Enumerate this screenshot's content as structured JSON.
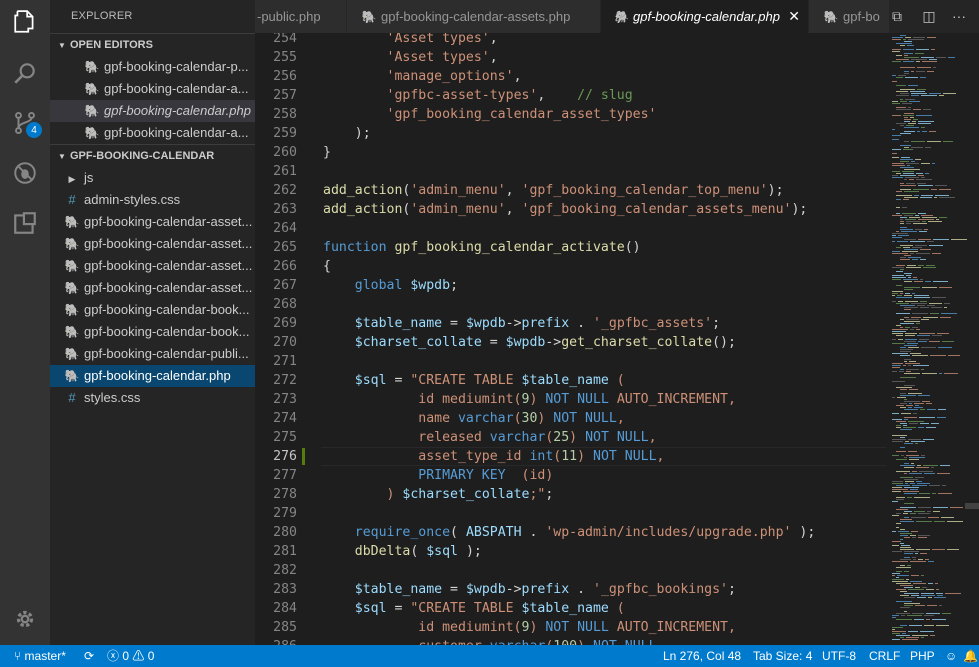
{
  "explorer": {
    "title": "EXPLORER",
    "open_editors_header": "OPEN EDITORS",
    "open_editors": [
      "gpf-booking-calendar-p...",
      "gpf-booking-calendar-a...",
      "gpf-booking-calendar.php",
      "gpf-booking-calendar-a..."
    ],
    "project_header": "GPF-BOOKING-CALENDAR",
    "files": [
      {
        "name": "js",
        "type": "folder"
      },
      {
        "name": "admin-styles.css",
        "type": "css"
      },
      {
        "name": "gpf-booking-calendar-asset...",
        "type": "php"
      },
      {
        "name": "gpf-booking-calendar-asset...",
        "type": "php"
      },
      {
        "name": "gpf-booking-calendar-asset...",
        "type": "php"
      },
      {
        "name": "gpf-booking-calendar-asset...",
        "type": "php"
      },
      {
        "name": "gpf-booking-calendar-book...",
        "type": "php"
      },
      {
        "name": "gpf-booking-calendar-book...",
        "type": "php"
      },
      {
        "name": "gpf-booking-calendar-publi...",
        "type": "php"
      },
      {
        "name": "gpf-booking-calendar.php",
        "type": "php"
      },
      {
        "name": "styles.css",
        "type": "css"
      }
    ]
  },
  "activity_bar": {
    "icons": [
      "files-icon",
      "search-icon",
      "source-control-icon",
      "debug-icon",
      "extensions-icon"
    ],
    "scm_badge": "4",
    "settings_icon": "gear-icon"
  },
  "tabs": [
    {
      "label": "-public.php",
      "icon": "php-icon"
    },
    {
      "label": "gpf-booking-calendar-assets.php",
      "icon": "php-icon"
    },
    {
      "label": "gpf-booking-calendar.php",
      "icon": "php-icon",
      "active": true
    },
    {
      "label": "gpf-bo",
      "icon": "php-icon"
    }
  ],
  "editor": {
    "line_numbers": [
      "254",
      "255",
      "256",
      "257",
      "258",
      "259",
      "260",
      "261",
      "262",
      "263",
      "264",
      "265",
      "266",
      "267",
      "268",
      "269",
      "270",
      "271",
      "272",
      "273",
      "274",
      "275",
      "276",
      "277",
      "278",
      "279",
      "280",
      "281",
      "282",
      "283",
      "284",
      "285"
    ],
    "current_line": "276"
  },
  "statusbar": {
    "branch": "master*",
    "errors": "0",
    "warnings": "0",
    "position": "Ln 276, Col 48",
    "tab_size": "Tab Size: 4",
    "encoding": "UTF-8",
    "eol": "CRLF",
    "language": "PHP"
  },
  "colors": {
    "accent": "#007acc",
    "sidebar_bg": "#252526",
    "editor_bg": "#1e1e1e"
  }
}
